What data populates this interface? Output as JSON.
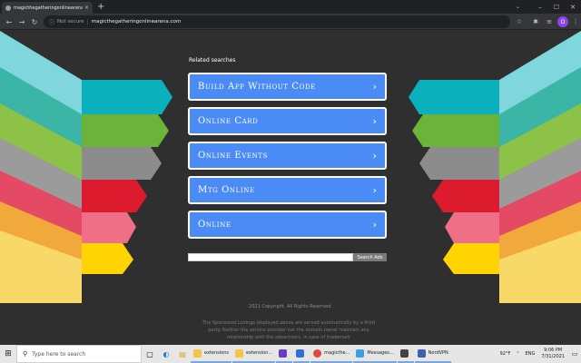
{
  "browser": {
    "tab_title": "magicthegatheringonlinearena.co",
    "tab_close": "×",
    "new_tab": "+",
    "tab_search": "⌄",
    "window_controls": {
      "minimize": "–",
      "maximize": "☐",
      "close": "✕"
    },
    "back": "←",
    "forward": "→",
    "reload": "↻",
    "security_icon": "ⓘ",
    "security_label": "Not secure",
    "separator": "|",
    "url": "magicthegatheringonlinearena.com",
    "bookmark_star": "☆",
    "extensions": "✱",
    "media": "≡",
    "profile_initial": "D",
    "menu": "⋮"
  },
  "page": {
    "related_title": "Related searches",
    "links": [
      {
        "label": "Build App Without Code",
        "chevron": "›"
      },
      {
        "label": "Online Card",
        "chevron": "›"
      },
      {
        "label": "Online Events",
        "chevron": "›"
      },
      {
        "label": "Mtg Online",
        "chevron": "›"
      },
      {
        "label": "Online",
        "chevron": "›"
      }
    ],
    "search_value": "",
    "search_button": "Search Ads",
    "copyright": "2021 Copyright. All Rights Reserved.",
    "disclaimer": "The Sponsored Listings displayed above are served automatically by a third party. Neither the service provider nor the domain owner maintain any relationship with the advertisers. In case of trademark"
  },
  "taskbar": {
    "start_icon": "⊞",
    "search_icon": "⚲",
    "search_placeholder": "Type here to search",
    "task_view_icon": "▢",
    "edge_icon": "◐",
    "explorer_icon": "▤",
    "apps": [
      {
        "label": "extensions",
        "color": "#f4c542"
      },
      {
        "label": "extension...",
        "color": "#f4c542"
      },
      {
        "label": "",
        "color": "#6a3cc4"
      },
      {
        "label": "",
        "color": "#2f6fd6"
      },
      {
        "label": "magicthe...",
        "color": "#e2453a"
      },
      {
        "label": "Messages...",
        "color": "#3aa0e2"
      },
      {
        "label": "",
        "color": "#444444"
      },
      {
        "label": "NordVPN",
        "color": "#3d5fae"
      }
    ],
    "weather": "92°F",
    "tray_arrow": "⌃",
    "language": "ENG",
    "time": "9:06 PM",
    "date": "7/31/2021",
    "notification_icon": "▭"
  },
  "colors": {
    "background": "#2f2f2f",
    "button_blue": "#4a8bf5",
    "stripes": [
      "#5cc8cf",
      "#35b6ad",
      "#7fba3c",
      "#8a8a8a",
      "#dc1c2e",
      "#e8476a",
      "#f4a11e",
      "#f9d423"
    ]
  }
}
